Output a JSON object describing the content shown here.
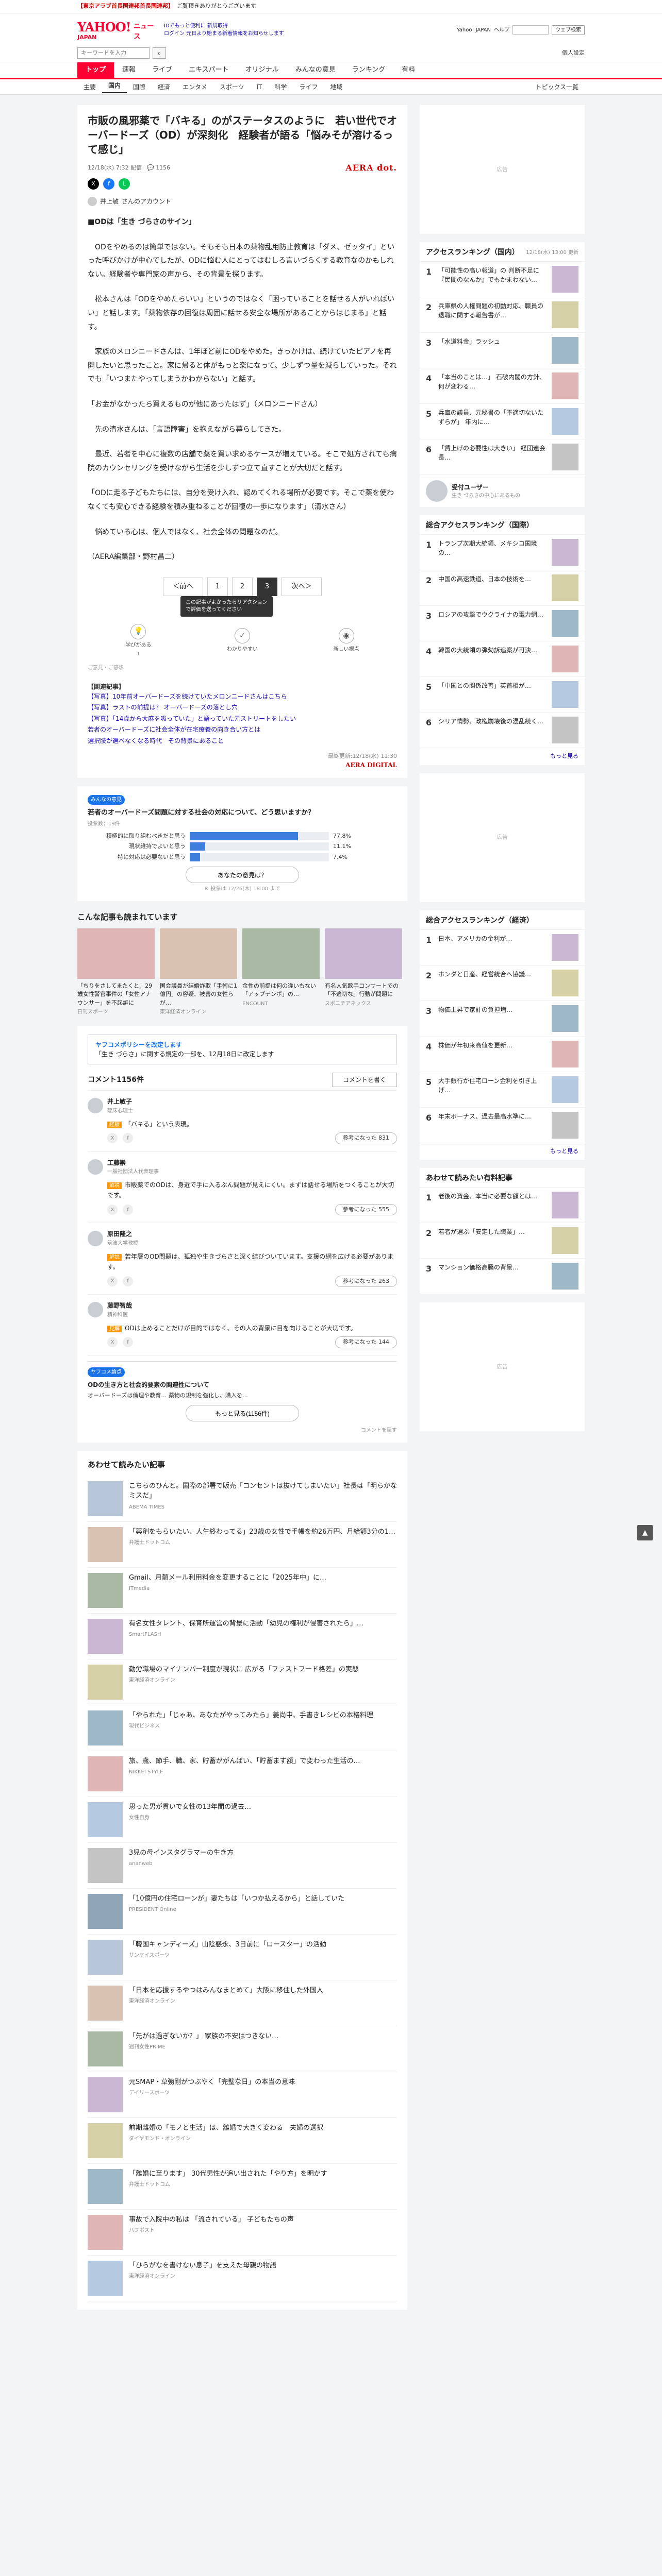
{
  "notice": {
    "red": "【東京アラブ首長国連邦首長国連邦】",
    "text": "ご覧頂きありがとうございます"
  },
  "header": {
    "logo": "YAHOO!",
    "logo_sub": "JAPAN",
    "service": "ニュース",
    "links_line1": "IDでもっと便利に 新規取得",
    "links_line2": "ログイン 元日より始まる新着情報をお知らせします",
    "right_links": [
      "Yahoo! JAPAN",
      "ヘルプ"
    ],
    "search_mini_placeholder": "",
    "search_mini_btn": "ウェブ検索",
    "search_placeholder": "キーワードを入力",
    "login": "個人設定"
  },
  "categories": [
    "トップ",
    "速報",
    "ライブ",
    "エキスパート",
    "オリジナル",
    "みんなの意見",
    "ランキング",
    "有料"
  ],
  "subnav": [
    "主要",
    "国内",
    "国際",
    "経済",
    "エンタメ",
    "スポーツ",
    "IT",
    "科学",
    "ライフ",
    "地域"
  ],
  "subnav_right": "トピックス一覧",
  "article": {
    "title": "市販の風邪薬で「バキる」のがステータスのように　若い世代でオーバードーズ（OD）が深刻化　経験者が語る「悩みそが溶けるって感じ」",
    "date": "12/18(水) 7:32 配信",
    "comments_count": "1156",
    "media": "AERA dot.",
    "author": "井上敏",
    "author_suffix": "さんのアカウント",
    "paragraphs": [
      "■ODは「生き づらさのサイン」",
      "　ODをやめるのは簡単ではない。そもそも日本の薬物乱用防止教育は「ダメ、ゼッタイ」といった呼びかけが中心でしたが、ODに悩む人にとってはむしろ言いづらくする教育なのかもしれない。経験者や専門家の声から、その背景を探ります。",
      "　松本さんは「ODをやめたらいい」というのではなく「困っていることを話せる人がいればいい」と話します。「薬物依存の回復は周囲に話せる安全な場所があることからはじまる」と話す。",
      "　家族のメロンニードさんは、1年ほど前にODをやめた。きっかけは、続けていたピアノを再開したいと思ったこと。家に帰ると体がもっと楽になって、少しずつ量を減らしていった。それでも「いつまたやってしまうかわからない」と話す。",
      "「お金がなかったら買えるものが他にあったはず」（メロンニードさん）",
      "　先の清水さんは、「言語障害」を抱えながら暮らしてきた。",
      "　最近、若者を中心に複数の店舗で薬を買い求めるケースが増えている。そこで処方されても病院のカウンセリングを受けながら生活を少しずつ立て直すことが大切だと話す。",
      "「ODに走る子どもたちには、自分を受け入れ、認めてくれる場所が必要です。そこで薬を使わなくても安心できる経験を積み重ねることが回復の一歩になります」（清水さん）",
      "　悩めている心は、個人ではなく、社会全体の問題なのだ。",
      "（AERA編集部・野村昌二）"
    ],
    "last_updated": "最終更新:12/18(水) 11:30",
    "publisher_logo": "AERA DIGITAL"
  },
  "pager": {
    "prev": "＜前へ",
    "pages": [
      "1",
      "2",
      "3"
    ],
    "current": "3",
    "next": "次へ＞",
    "caption": "3/3ページ"
  },
  "reactions": {
    "tooltip_line1": "この記事がよかったらリアクション",
    "tooltip_line2": "で評価を送ってください",
    "items": [
      {
        "label": "学びがある",
        "count": "1",
        "icon": "lightbulb-icon"
      },
      {
        "label": "わかりやすい",
        "count": "",
        "icon": "check-icon"
      },
      {
        "label": "新しい視点",
        "count": "",
        "icon": "eye-icon"
      }
    ],
    "note": "ご意見・ご感想"
  },
  "related": {
    "title": "【関連記事】",
    "links": [
      "【写真】10年前オーバードーズを続けていたメロンニードさんはこちら",
      "【写真】ラストの前提は？ オーバードーズの落とし穴",
      "【写真】「14歳から大麻を吸っていた」と語っていた元ストリートをしたい",
      "若者のオーバードーズに社会全体が在宅療養の向き合い方とは",
      "選択肢が選べなくなる時代　その背景にあること"
    ]
  },
  "poll": {
    "badge": "みんなの意見",
    "question": "若者のオーバードーズ問題に対する社会の対応について、どう思いますか？",
    "meta": "投票数：19件",
    "options": [
      {
        "label": "積極的に取り組むべきだと思う",
        "pct": 77.8,
        "pct_text": "77.8%"
      },
      {
        "label": "現状維持でよいと思う",
        "pct": 11.1,
        "pct_text": "11.1%"
      },
      {
        "label": "特に対応は必要ないと思う",
        "pct": 7.4,
        "pct_text": "7.4%"
      }
    ],
    "button": "あなたの意見は？",
    "note": "※ 投票は 12/26(木) 18:00 まで"
  },
  "recommended": {
    "title": "こんな記事も読まれています",
    "items": [
      {
        "title": "「ちりをさしてまたくと」29歳女性警官事件の「女性アナウンサー」を不起訴に",
        "src": "日刊スポーツ"
      },
      {
        "title": "国会議員が結婚詐欺「手術に1億円」の容疑、被害の女性らが…",
        "src": "東洋経済オンライン"
      },
      {
        "title": "金性の前提は何の違いもない 「アップテンポ」の…",
        "src": "ENCOUNT"
      },
      {
        "title": "有名人気歌手コンサートでの「不適切な」行動が問題に",
        "src": "スポニチアネックス"
      }
    ]
  },
  "comments": {
    "policy_title": "ヤフコメポリシーを改定します",
    "policy_text": "「生き づらさ」に関する規定の一部を、12月18日に改定します",
    "count_label": "コメント1156件",
    "post_button": "コメントを書く",
    "list": [
      {
        "name": "井上敏子",
        "role": "臨床心理士",
        "tag": "経験",
        "text": "「バキる」という表現。",
        "like": "参考になった 831"
      },
      {
        "name": "工藤崇",
        "role": "一般社団法人代表理事",
        "tag": "解説",
        "text": "市販薬でのODは、身近で手に入るぶん問題が見えにくい。まずは話せる場所をつくることが大切です。",
        "like": "参考になった 555"
      },
      {
        "name": "原田隆之",
        "role": "筑波大学教授",
        "tag": "解説",
        "text": "若年層のOD問題は、孤独や生きづらさと深く結びついています。支援の網を広げる必要があります。",
        "like": "参考になった 263"
      },
      {
        "name": "藤野智哉",
        "role": "精神科医",
        "tag": "見解",
        "text": "ODは止めることだけが目的ではなく、その人の背景に目を向けることが大切です。",
        "like": "参考になった 144"
      }
    ],
    "debate_label": "ヤフコメ論点",
    "debate_title": "ODの生き方と社会的要素の関連性について",
    "debate_bullet": "オーバードーズは倫理や教育… 薬物の規制を強化し、購入を…",
    "debate_more": "もっと見る(1156件)",
    "hide_label": "コメントを隠す"
  },
  "also_read": {
    "title": "あわせて読みたい記事",
    "items": [
      {
        "title": "こちらのひんと。国際の部署で販売「コンセントは抜けてしまいたい」社長は「明らかなミスだ」",
        "src": "ABEMA TIMES"
      },
      {
        "title": "「薬剤をもらいたい、人生終わってる」23歳の女性で手帳を約26万円、月給額3分の1…",
        "src": "弁護士ドットコム"
      },
      {
        "title": "Gmail、月額メール利用料金を変更することに「2025年中」に…",
        "src": "ITmedia"
      },
      {
        "title": "有名女性タレント、保育所運営の背景に活動「幼児の権利が侵害されたら」…",
        "src": "SmartFLASH"
      },
      {
        "title": "勤労職場のマイナンバー制度が現状に 広がる「ファストフード格差」の実態",
        "src": "東洋経済オンライン"
      },
      {
        "title": "「やられた」「じゃあ、あなたがやってみたら」姜尚中、手書きレシピの本格料理",
        "src": "現代ビジネス"
      },
      {
        "title": "旅、歳、節手、職、家、貯蓄ががんばい、「貯蓄ます額」で変わった生活の…",
        "src": "NIKKEI STYLE"
      },
      {
        "title": "思った男が貢いで女性の13年間の過去…",
        "src": "女性自身"
      },
      {
        "title": "3児の母インスタグラマーの生き方",
        "src": "ananweb"
      },
      {
        "title": "「10億円の住宅ローンが」妻たちは「いつか払えるから」と話していた",
        "src": "PRESIDENT Online"
      },
      {
        "title": "「韓国キャンディーズ」山陰惑永、3日前に「ロースター」の活動",
        "src": "サンケイスポーツ"
      },
      {
        "title": "「日本を応援するやつはみんなまとめて」大阪に移住した外国人",
        "src": "東洋経済オンライン"
      },
      {
        "title": "「先がは過ぎないか？」 家族の不安はつきない…",
        "src": "週刊女性PRIME"
      },
      {
        "title": "元SMAP・草彅剛がつぶやく「完璧な日」の本当の意味",
        "src": "デイリースポーツ"
      },
      {
        "title": "前期離婚の「モノと生活」は、離婚で大きく変わる　夫婦の選択",
        "src": "ダイヤモンド・オンライン"
      },
      {
        "title": "「離婚に至ります」 30代男性が追い出された「やり方」を明かす",
        "src": "弁護士ドットコム"
      },
      {
        "title": "事故で入院中の私は 「流されている」 子どもたちの声",
        "src": "ハフポスト"
      },
      {
        "title": "「ひらがなを書けない息子」を支えた母親の物語",
        "src": "東洋経済オンライン"
      }
    ]
  },
  "side": {
    "access_title": "アクセスランキング（国内）",
    "access_sub": "12/18(水) 13:00 更新",
    "access": [
      "「可能性の高い報道」の 判断不足に 『民間のなんか』でもかまわない…",
      "兵庫県の人権問題の初動対応、職員の退職に関する報告書が…",
      "「水道料金」ラッシュ",
      "「本当のことは…」 石破内閣の方針、何が変わる…",
      "兵庫の議員、元秘書の「不適切ないたずらが」 年内に…",
      "「賃上げの必要性は大きい」 経団連会長…"
    ],
    "expert_title": "エキスパートのコメント",
    "expert_name": "受付ユーザー",
    "expert_text": "生き づらさの中心にあるもの",
    "comment_rank_title": "総合アクセスランキング（国際）",
    "comment_rank": [
      "トランプ次期大統領、メキシコ国境の…",
      "中国の高速鉄道、日本の技術を…",
      "ロシアの攻撃でウクライナの電力網…",
      "韓国の大統領の弾劾訴追案が可決…",
      "「中国との関係改善」英首相が…",
      "シリア情勢、政権崩壊後の混乱続く…"
    ],
    "biz_title": "総合アクセスランキング（経済）",
    "biz": [
      "日本、アメリカの金利が…",
      "ホンダと日産、経営統合へ協議…",
      "物価上昇で家計の負担増…",
      "株価が年初来高値を更新…",
      "大手銀行が住宅ローン金利を引き上げ…",
      "年末ボーナス、過去最高水準に…"
    ],
    "paid_title": "あわせて読みたい有料記事",
    "paid": [
      "老後の資金、本当に必要な額とは…",
      "若者が選ぶ「安定した職業」…",
      "マンション価格高騰の背景…"
    ],
    "more": "もっと見る",
    "ad_label": "広告"
  }
}
